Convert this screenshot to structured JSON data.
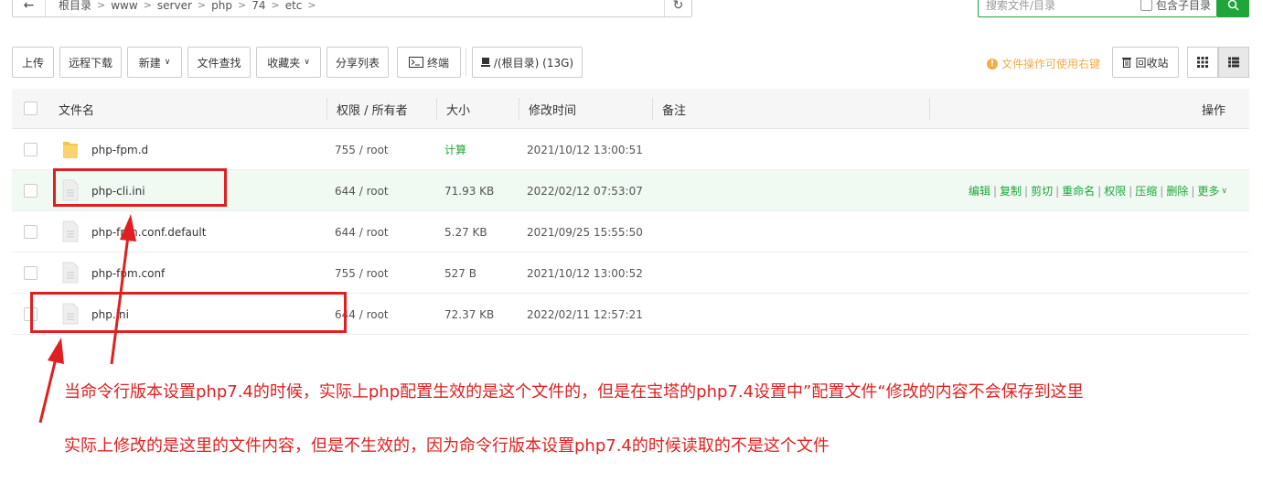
{
  "pathbar": {
    "crumbs": [
      "根目录",
      "www",
      "server",
      "php",
      "74",
      "etc"
    ]
  },
  "search": {
    "placeholder": "搜索文件/目录",
    "include_subdir": "包含子目录"
  },
  "toolbar": {
    "upload": "上传",
    "remote_download": "远程下载",
    "new": "新建",
    "find": "文件查找",
    "favorites": "收藏夹",
    "share_list": "分享列表",
    "terminal": "终端",
    "disk": "/(根目录) (13G)",
    "tip": "文件操作可使用右键",
    "recycle": "回收站"
  },
  "table": {
    "headers": {
      "name": "文件名",
      "perm": "权限 / 所有者",
      "size": "大小",
      "mtime": "修改时间",
      "note": "备注",
      "ops": "操作"
    },
    "rows": [
      {
        "name": "php-fpm.d",
        "perm": "755 / root",
        "size": "计算",
        "mtime": "2021/10/12 13:00:51",
        "type": "folder"
      },
      {
        "name": "php-cli.ini",
        "perm": "644 / root",
        "size": "71.93 KB",
        "mtime": "2022/02/12 07:53:07",
        "type": "file"
      },
      {
        "name": "php-fpm.conf.default",
        "perm": "644 / root",
        "size": "5.27 KB",
        "mtime": "2021/09/25 15:55:50",
        "type": "file"
      },
      {
        "name": "php-fpm.conf",
        "perm": "755 / root",
        "size": "527 B",
        "mtime": "2021/10/12 13:00:52",
        "type": "file"
      },
      {
        "name": "php.ini",
        "perm": "644 / root",
        "size": "72.37 KB",
        "mtime": "2022/02/11 12:57:21",
        "type": "file"
      }
    ],
    "row_ops": [
      "编辑",
      "复制",
      "剪切",
      "重命名",
      "权限",
      "压缩",
      "删除",
      "更多"
    ]
  },
  "annotations": {
    "line1": "当命令行版本设置php7.4的时候，实际上php配置生效的是这个文件的，但是在宝塔的php7.4设置中”配置文件“修改的内容不会保存到这里",
    "line2": "实际上修改的是这里的文件内容，但是不生效的，因为命令行版本设置php7.4的时候读取的不是这个文件"
  },
  "colors": {
    "accent": "#20a53a",
    "annotation": "#e02020",
    "tip": "#f0ad4e"
  }
}
